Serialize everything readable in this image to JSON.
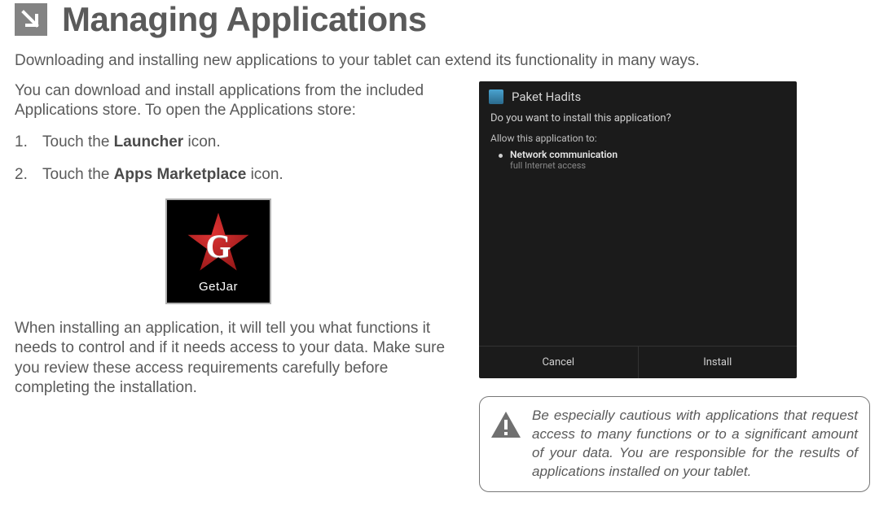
{
  "header": {
    "title": "Managing Applications"
  },
  "intro": "Downloading and installing new applications to your tablet can extend its functionality in many ways.",
  "left": {
    "para1": "You can download and install applications from the included Applications store. To open the Applications store:",
    "steps": [
      {
        "num": "1.",
        "prefix": "Touch the ",
        "bold": "Launcher",
        "suffix": " icon."
      },
      {
        "num": "2.",
        "prefix": "Touch the ",
        "bold": "Apps Marketplace",
        "suffix": " icon."
      }
    ],
    "getjar": {
      "letter": "G",
      "label": "GetJar"
    },
    "para2": "When installing an application, it will tell you what functions it needs to control and if it needs access to your data. Make sure you review these access requirements carefully before completing the installation."
  },
  "android_dialog": {
    "app_name": "Paket Hadits",
    "question": "Do you want to install this application?",
    "allow_label": "Allow this application to:",
    "permission_head": "Network communication",
    "permission_sub": "full Internet access",
    "cancel": "Cancel",
    "install": "Install"
  },
  "caution": "Be especially cautious with applications that request access to many functions or to a significant amount of your data. You are responsible for the results of applications installed on your tablet."
}
